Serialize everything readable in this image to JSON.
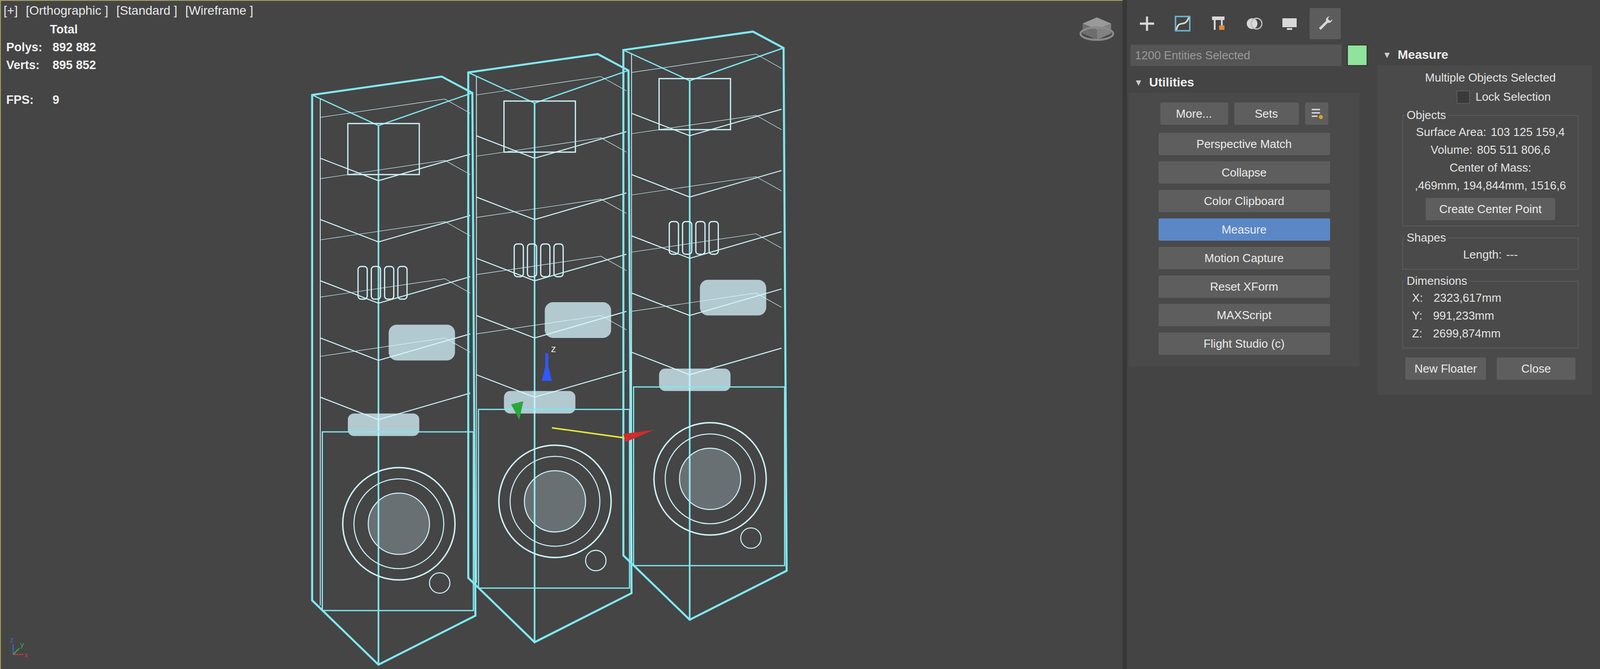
{
  "viewport": {
    "labels": [
      "[+]",
      "[Orthographic ]",
      "[Standard ]",
      "[Wireframe ]"
    ],
    "stats": {
      "title": "Total",
      "rows": [
        {
          "label": "Polys:",
          "value": "892 882"
        },
        {
          "label": "Verts:",
          "value": "895 852"
        }
      ],
      "fps_label": "FPS:",
      "fps": "9"
    },
    "gizmo": {
      "z": "z"
    },
    "axis_tripod": {
      "x": "x",
      "y": "y",
      "z": "z"
    }
  },
  "command_tabs": [
    {
      "kind": "create",
      "selected": false
    },
    {
      "kind": "modify",
      "selected": false
    },
    {
      "kind": "hierarchy",
      "selected": false
    },
    {
      "kind": "motion",
      "selected": false
    },
    {
      "kind": "display",
      "selected": false
    },
    {
      "kind": "utilities",
      "selected": true
    }
  ],
  "selection": {
    "text": "1200 Entities Selected",
    "color": "#8fe39a"
  },
  "utilities": {
    "toggle": "▼",
    "title": "Utilities",
    "top_buttons": [
      "More...",
      "Sets"
    ],
    "buttons": [
      {
        "label": "Perspective Match",
        "selected": false
      },
      {
        "label": "Collapse",
        "selected": false
      },
      {
        "label": "Color Clipboard",
        "selected": false
      },
      {
        "label": "Measure",
        "selected": true
      },
      {
        "label": "Motion Capture",
        "selected": false
      },
      {
        "label": "Reset XForm",
        "selected": false
      },
      {
        "label": "MAXScript",
        "selected": false
      },
      {
        "label": "Flight Studio (c)",
        "selected": false
      }
    ]
  },
  "measure": {
    "toggle": "▼",
    "title": "Measure",
    "status": "Multiple Objects Selected",
    "lock": {
      "label": "Lock Selection",
      "checked": false
    },
    "objects": {
      "title": "Objects",
      "rows": [
        {
          "label": "Surface Area:",
          "value": "103 125 159,4"
        },
        {
          "label": "Volume:",
          "value": "805 511 806,6"
        }
      ],
      "com_label": "Center of Mass:",
      "com": ",469mm, 194,844mm, 1516,6",
      "button": "Create Center Point"
    },
    "shapes": {
      "title": "Shapes",
      "label": "Length:",
      "value": "---"
    },
    "dimensions": {
      "title": "Dimensions",
      "rows": [
        {
          "axis": "X:",
          "value": "2323,617mm"
        },
        {
          "axis": "Y:",
          "value": "991,233mm"
        },
        {
          "axis": "Z:",
          "value": "2699,874mm"
        }
      ]
    },
    "buttons": [
      "New Floater",
      "Close"
    ]
  }
}
